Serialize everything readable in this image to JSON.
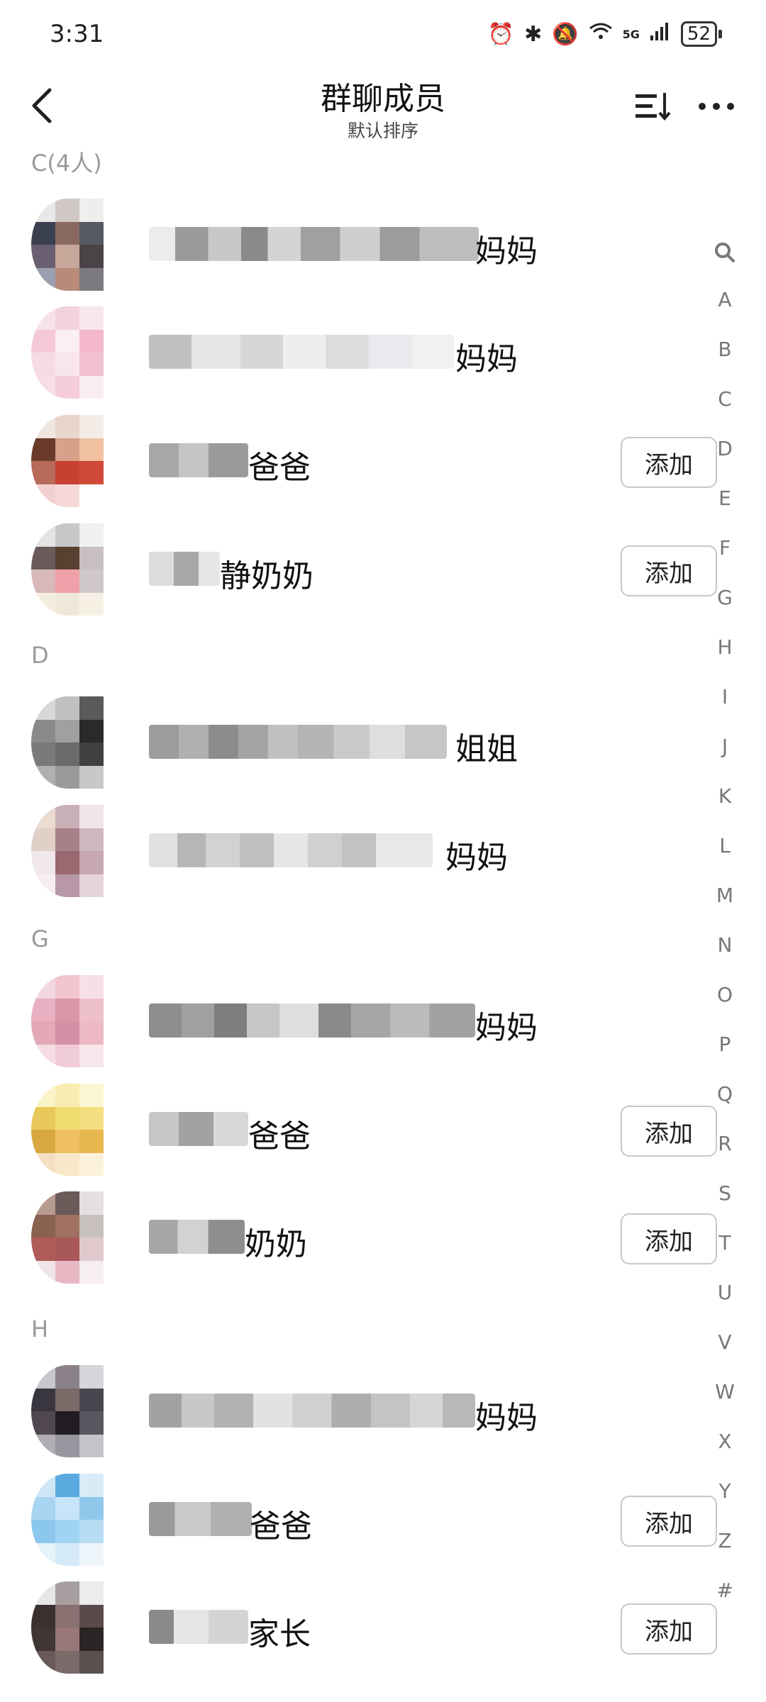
{
  "status_bar": {
    "time": "3:31",
    "battery": "52",
    "network": "5G"
  },
  "header": {
    "title": "群聊成员",
    "subtitle": "默认排序"
  },
  "sections": {
    "c": "C(4人)",
    "d": "D",
    "g": "G",
    "h": "H"
  },
  "add_label": "添加",
  "members": [
    {
      "suffix": "妈妈",
      "has_add": false
    },
    {
      "suffix": "妈妈",
      "has_add": false
    },
    {
      "suffix": "爸爸",
      "has_add": true
    },
    {
      "suffix": "静奶奶",
      "has_add": true
    },
    {
      "suffix": "姐姐",
      "has_add": false
    },
    {
      "suffix": "妈妈",
      "has_add": false
    },
    {
      "suffix": "妈妈",
      "has_add": false
    },
    {
      "suffix": "爸爸",
      "has_add": true
    },
    {
      "suffix": "奶奶",
      "has_add": true
    },
    {
      "suffix": "妈妈",
      "has_add": false
    },
    {
      "suffix": "爸爸",
      "has_add": true
    },
    {
      "suffix": "家长",
      "has_add": true
    }
  ],
  "index_letters": [
    "A",
    "B",
    "C",
    "D",
    "E",
    "F",
    "G",
    "H",
    "I",
    "J",
    "K",
    "L",
    "M",
    "N",
    "O",
    "P",
    "Q",
    "R",
    "S",
    "T",
    "U",
    "V",
    "W",
    "X",
    "Y",
    "Z",
    "#"
  ],
  "colors": {
    "accent_text": "#111111",
    "section_text": "#9a9a9a",
    "index_text": "#777777",
    "button_border": "#c8c8c8"
  },
  "icons": {
    "back": "chevron-left-icon",
    "sort": "sort-icon",
    "more": "more-icon",
    "search": "search-icon"
  }
}
